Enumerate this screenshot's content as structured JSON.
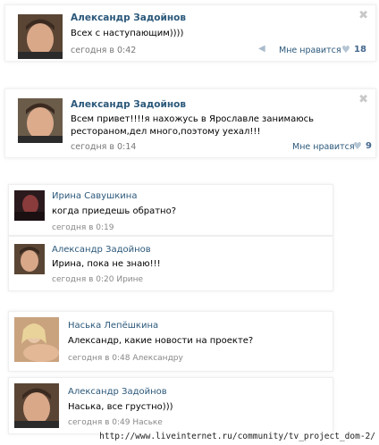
{
  "posts": [
    {
      "author": "Александр Задойнов",
      "text": "Всех с наступающим))))",
      "date": "сегодня в 0:42",
      "like_label": "Мне нравится",
      "likes": "18"
    },
    {
      "author": "Александр Задойнов",
      "text_line1": "Всем привет!!!!я нахожусь в Ярославле занимаюсь",
      "text_line2": "ресторaном,дел много,поэтому уехал!!!",
      "date": "сегодня в 0:14",
      "like_label": "Мне нравится",
      "likes": "9"
    }
  ],
  "thread1": [
    {
      "author": "Ирина Савушкина",
      "text": "когда приедешь обратно?",
      "date": "сегодня в 0:19"
    },
    {
      "author": "Александр Задойнов",
      "text": "Ирина, пока не знаю!!!",
      "date": "сегодня в 0:20 Ирине"
    }
  ],
  "thread2": [
    {
      "author": "Наська Лепёшкина",
      "text": "Александр, какие новости на проекте?",
      "date": "сегодня в 0:48 Александру"
    },
    {
      "author": "Александр Задойнов",
      "text": "Наська, все грустно)))",
      "date": "сегодня в 0:49 Наське"
    }
  ],
  "icons": {
    "close": "close-icon",
    "share": "share-icon",
    "heart": "heart-icon"
  },
  "colors": {
    "link": "#2b587a",
    "muted": "#777777",
    "like_count": "#45688e"
  },
  "watermark": "http://www.liveinternet.ru/community/tv_project_dom-2/"
}
